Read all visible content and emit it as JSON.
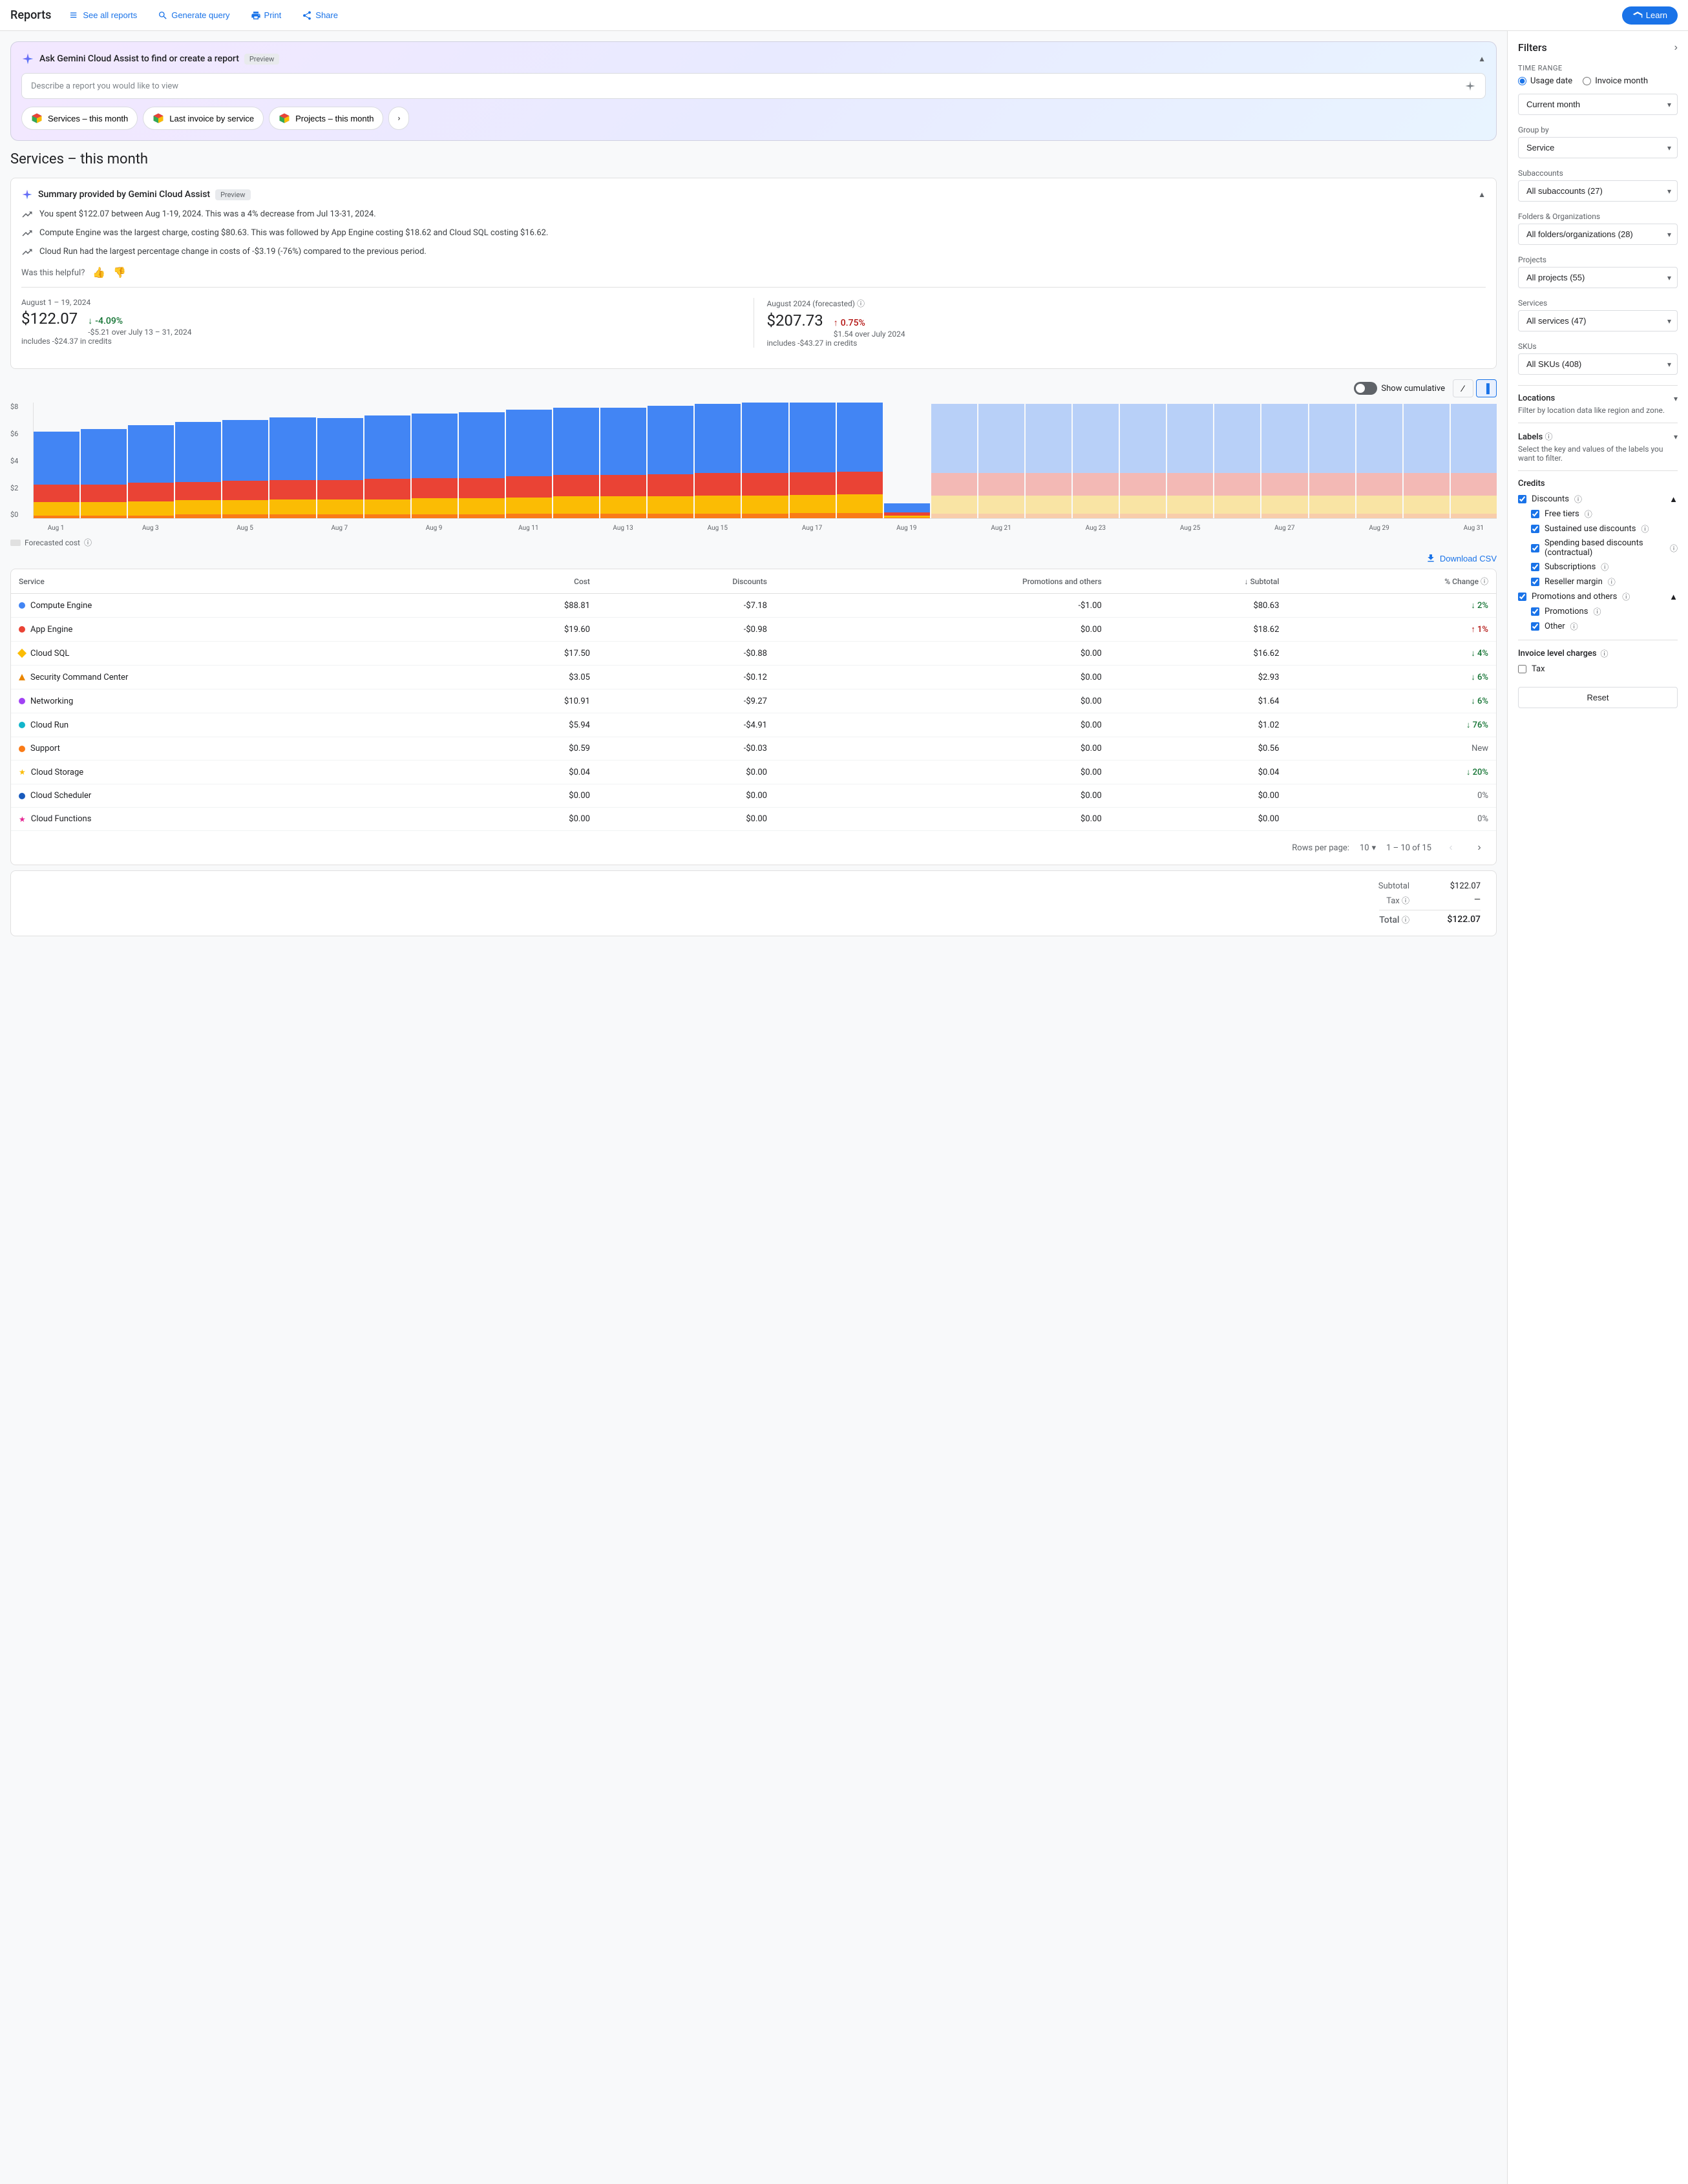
{
  "topNav": {
    "title": "Reports",
    "seeAllReports": "See all reports",
    "generateQuery": "Generate query",
    "print": "Print",
    "share": "Share",
    "learn": "Learn"
  },
  "gemini": {
    "title": "Ask Gemini Cloud Assist to find or create a report",
    "previewBadge": "Preview",
    "inputPlaceholder": "Describe a report you would like to view",
    "quickReports": [
      "Services – this month",
      "Last invoice by service",
      "Projects – this month"
    ]
  },
  "pageTitle": "Services – this month",
  "summary": {
    "title": "Summary provided by Gemini Cloud Assist",
    "previewBadge": "Preview",
    "points": [
      "You spent $122.07 between Aug 1-19, 2024. This was a 4% decrease from Jul 13-31, 2024.",
      "Compute Engine was the largest charge, costing $80.63. This was followed by App Engine costing $18.62 and Cloud SQL costing $16.62.",
      "Cloud Run had the largest percentage change in costs of -$3.19 (-76%) compared to the previous period."
    ],
    "helpfulText": "Was this helpful?"
  },
  "stats": {
    "current": {
      "period": "August 1 – 19, 2024",
      "value": "$122.07",
      "sub": "includes -$24.37 in credits",
      "change": "-4.09%",
      "changeSub": "-$5.21 over July 13 – 31, 2024",
      "changeType": "down"
    },
    "forecasted": {
      "period": "August 2024 (forecasted)",
      "value": "$207.73",
      "sub": "includes -$43.27 in credits",
      "change": "0.75%",
      "changeSub": "$1.54 over July 2024",
      "changeType": "up"
    }
  },
  "chart": {
    "showCumulative": "Show cumulative",
    "yLabels": [
      "$8",
      "$6",
      "$4",
      "$2",
      "$0"
    ],
    "xLabels": [
      "Aug 1",
      "Aug 3",
      "Aug 5",
      "Aug 7",
      "Aug 9",
      "Aug 11",
      "Aug 13",
      "Aug 15",
      "Aug 17",
      "Aug 19",
      "Aug 21",
      "Aug 23",
      "Aug 25",
      "Aug 27",
      "Aug 29",
      "Aug 31"
    ],
    "forecastedLegend": "Forecasted cost"
  },
  "table": {
    "downloadCSV": "Download CSV",
    "columns": [
      "Service",
      "Cost",
      "Discounts",
      "Promotions and others",
      "Subtotal",
      "% Change"
    ],
    "rows": [
      {
        "service": "Compute Engine",
        "cost": "$88.81",
        "discounts": "-$7.18",
        "promotions": "-$1.00",
        "subtotal": "$80.63",
        "change": "2%",
        "changeType": "down",
        "iconType": "dot-blue"
      },
      {
        "service": "App Engine",
        "cost": "$19.60",
        "discounts": "-$0.98",
        "promotions": "$0.00",
        "subtotal": "$18.62",
        "change": "1%",
        "changeType": "up",
        "iconType": "dot-red"
      },
      {
        "service": "Cloud SQL",
        "cost": "$17.50",
        "discounts": "-$0.88",
        "promotions": "$0.00",
        "subtotal": "$16.62",
        "change": "4%",
        "changeType": "down",
        "iconType": "diamond-yellow"
      },
      {
        "service": "Security Command Center",
        "cost": "$3.05",
        "discounts": "-$0.12",
        "promotions": "$0.00",
        "subtotal": "$2.93",
        "change": "6%",
        "changeType": "down",
        "iconType": "triangle-orange"
      },
      {
        "service": "Networking",
        "cost": "$10.91",
        "discounts": "-$9.27",
        "promotions": "$0.00",
        "subtotal": "$1.64",
        "change": "6%",
        "changeType": "down",
        "iconType": "dot-purple"
      },
      {
        "service": "Cloud Run",
        "cost": "$5.94",
        "discounts": "-$4.91",
        "promotions": "$0.00",
        "subtotal": "$1.02",
        "change": "76%",
        "changeType": "down",
        "iconType": "dot-teal"
      },
      {
        "service": "Support",
        "cost": "$0.59",
        "discounts": "-$0.03",
        "promotions": "$0.00",
        "subtotal": "$0.56",
        "change": "New",
        "changeType": "new",
        "iconType": "dot-orange"
      },
      {
        "service": "Cloud Storage",
        "cost": "$0.04",
        "discounts": "$0.00",
        "promotions": "$0.00",
        "subtotal": "$0.04",
        "change": "20%",
        "changeType": "down",
        "iconType": "star-yellow"
      },
      {
        "service": "Cloud Scheduler",
        "cost": "$0.00",
        "discounts": "$0.00",
        "promotions": "$0.00",
        "subtotal": "$0.00",
        "change": "0%",
        "changeType": "neutral",
        "iconType": "dot-navy"
      },
      {
        "service": "Cloud Functions",
        "cost": "$0.00",
        "discounts": "$0.00",
        "promotions": "$0.00",
        "subtotal": "$0.00",
        "change": "0%",
        "changeType": "neutral",
        "iconType": "star-pink"
      }
    ],
    "pagination": {
      "rowsPerPageLabel": "Rows per page:",
      "rowsPerPage": "10",
      "pageInfo": "1 – 10 of 15"
    }
  },
  "totals": {
    "subtotalLabel": "Subtotal",
    "subtotalValue": "$122.07",
    "taxLabel": "Tax",
    "taxValue": "—",
    "totalLabel": "Total",
    "totalValue": "$122.07"
  },
  "filters": {
    "title": "Filters",
    "timeRange": {
      "label": "Time range",
      "usageDate": "Usage date",
      "invoiceMonth": "Invoice month"
    },
    "currentMonth": "Current month",
    "groupBy": {
      "label": "Group by",
      "value": "Service"
    },
    "subaccounts": {
      "label": "Subaccounts",
      "value": "All subaccounts (27)"
    },
    "foldersOrgs": {
      "label": "Folders & Organizations",
      "value": "All folders/organizations (28)"
    },
    "projects": {
      "label": "Projects",
      "value": "All projects (55)"
    },
    "services": {
      "label": "Services",
      "value": "All services (47)"
    },
    "skus": {
      "label": "SKUs",
      "value": "All SKUs (408)"
    },
    "locations": {
      "label": "Locations",
      "sub": "Filter by location data like region and zone."
    },
    "labels": {
      "label": "Labels",
      "sub": "Select the key and values of the labels you want to filter."
    },
    "credits": {
      "label": "Credits",
      "discounts": {
        "label": "Discounts",
        "checked": true
      },
      "freeTiers": {
        "label": "Free tiers",
        "checked": true
      },
      "sustainedUseDiscounts": {
        "label": "Sustained use discounts",
        "checked": true
      },
      "spendingBasedDiscounts": {
        "label": "Spending based discounts (contractual)",
        "checked": true
      },
      "subscriptions": {
        "label": "Subscriptions",
        "checked": true
      },
      "resellerMargin": {
        "label": "Reseller margin",
        "checked": true
      },
      "promotionsAndOthers": {
        "label": "Promotions and others",
        "checked": true
      },
      "promotions": {
        "label": "Promotions",
        "checked": true
      },
      "other": {
        "label": "Other",
        "checked": true
      }
    },
    "invoiceLevelCharges": {
      "label": "Invoice level charges",
      "tax": {
        "label": "Tax",
        "checked": false
      }
    },
    "resetLabel": "Reset"
  }
}
